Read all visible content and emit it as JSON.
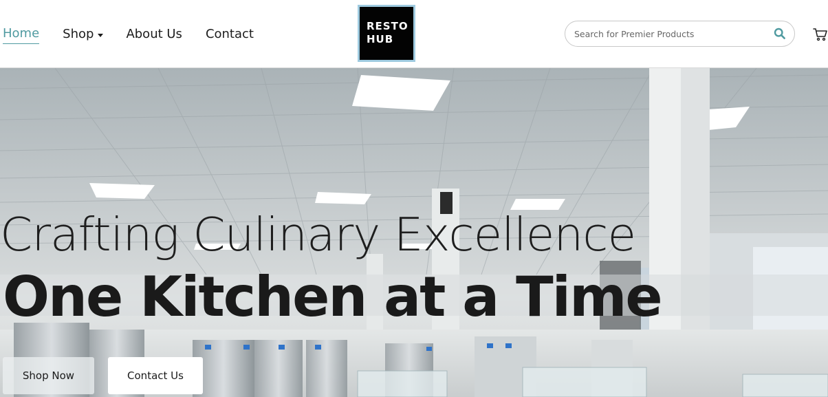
{
  "header": {
    "nav": {
      "home": "Home",
      "shop": "Shop",
      "about": "About Us",
      "contact": "Contact"
    },
    "logo": {
      "line1": "RESTO",
      "line2": "HUB"
    },
    "search": {
      "placeholder": "Search for Premier Products",
      "icon": "search-icon"
    },
    "cart_icon": "cart-icon"
  },
  "hero": {
    "line1": "Crafting Culinary Excellence",
    "line2": "One Kitchen at a Time",
    "buttons": {
      "shop_now": "Shop Now",
      "contact_us": "Contact Us"
    }
  },
  "colors": {
    "accent": "#4f9aa0",
    "logo_bg": "#030303",
    "logo_border": "#9fcbe0"
  }
}
